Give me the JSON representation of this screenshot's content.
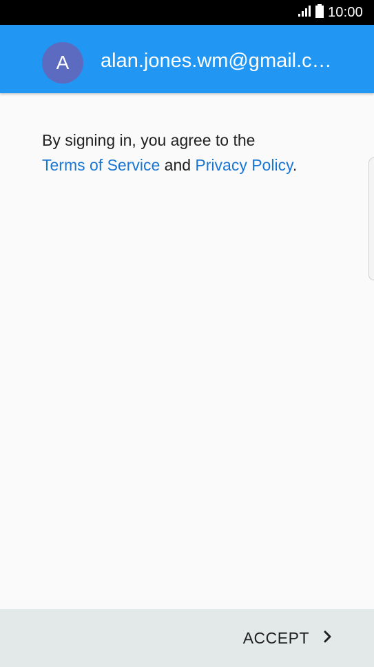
{
  "status_bar": {
    "time": "10:00",
    "signal_icon": "signal-icon",
    "battery_icon": "battery-icon"
  },
  "account": {
    "avatar_letter": "A",
    "email": "alan.jones.wm@gmail.c…"
  },
  "agreement": {
    "intro": "By signing in, you agree to the",
    "terms_link": "Terms of Service",
    "conjunction": " and ",
    "privacy_link": "Privacy Policy",
    "end": "."
  },
  "footer": {
    "accept_label": "ACCEPT",
    "accept_icon": "chevron-right-icon"
  },
  "colors": {
    "header": "#2196f3",
    "avatar": "#5c6bc0",
    "link": "#1976d2",
    "footer": "#e3e8e8",
    "background": "#fafafa"
  }
}
